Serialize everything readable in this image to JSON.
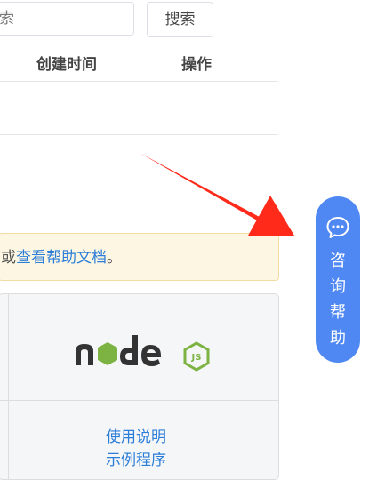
{
  "search": {
    "placeholder": "索",
    "button_label": "搜索"
  },
  "table": {
    "headers": {
      "created_time": "创建时间",
      "actions": "操作"
    }
  },
  "notice": {
    "prefix": "或",
    "link_text": "查看帮助文档",
    "suffix": "。"
  },
  "sdk_card": {
    "logo_text": "node",
    "logo_badge": "JS",
    "links": [
      "使用说明",
      "示例程序"
    ]
  },
  "help_button": {
    "chars": [
      "咨",
      "询",
      "帮",
      "助"
    ],
    "icon": "chat-bubble-icon"
  },
  "annotation": {
    "arrow_color": "#ff2a1a"
  },
  "colors": {
    "accent": "#4f88f2",
    "link": "#2b7dd8",
    "node_green": "#7cb342",
    "node_dark": "#333333"
  }
}
